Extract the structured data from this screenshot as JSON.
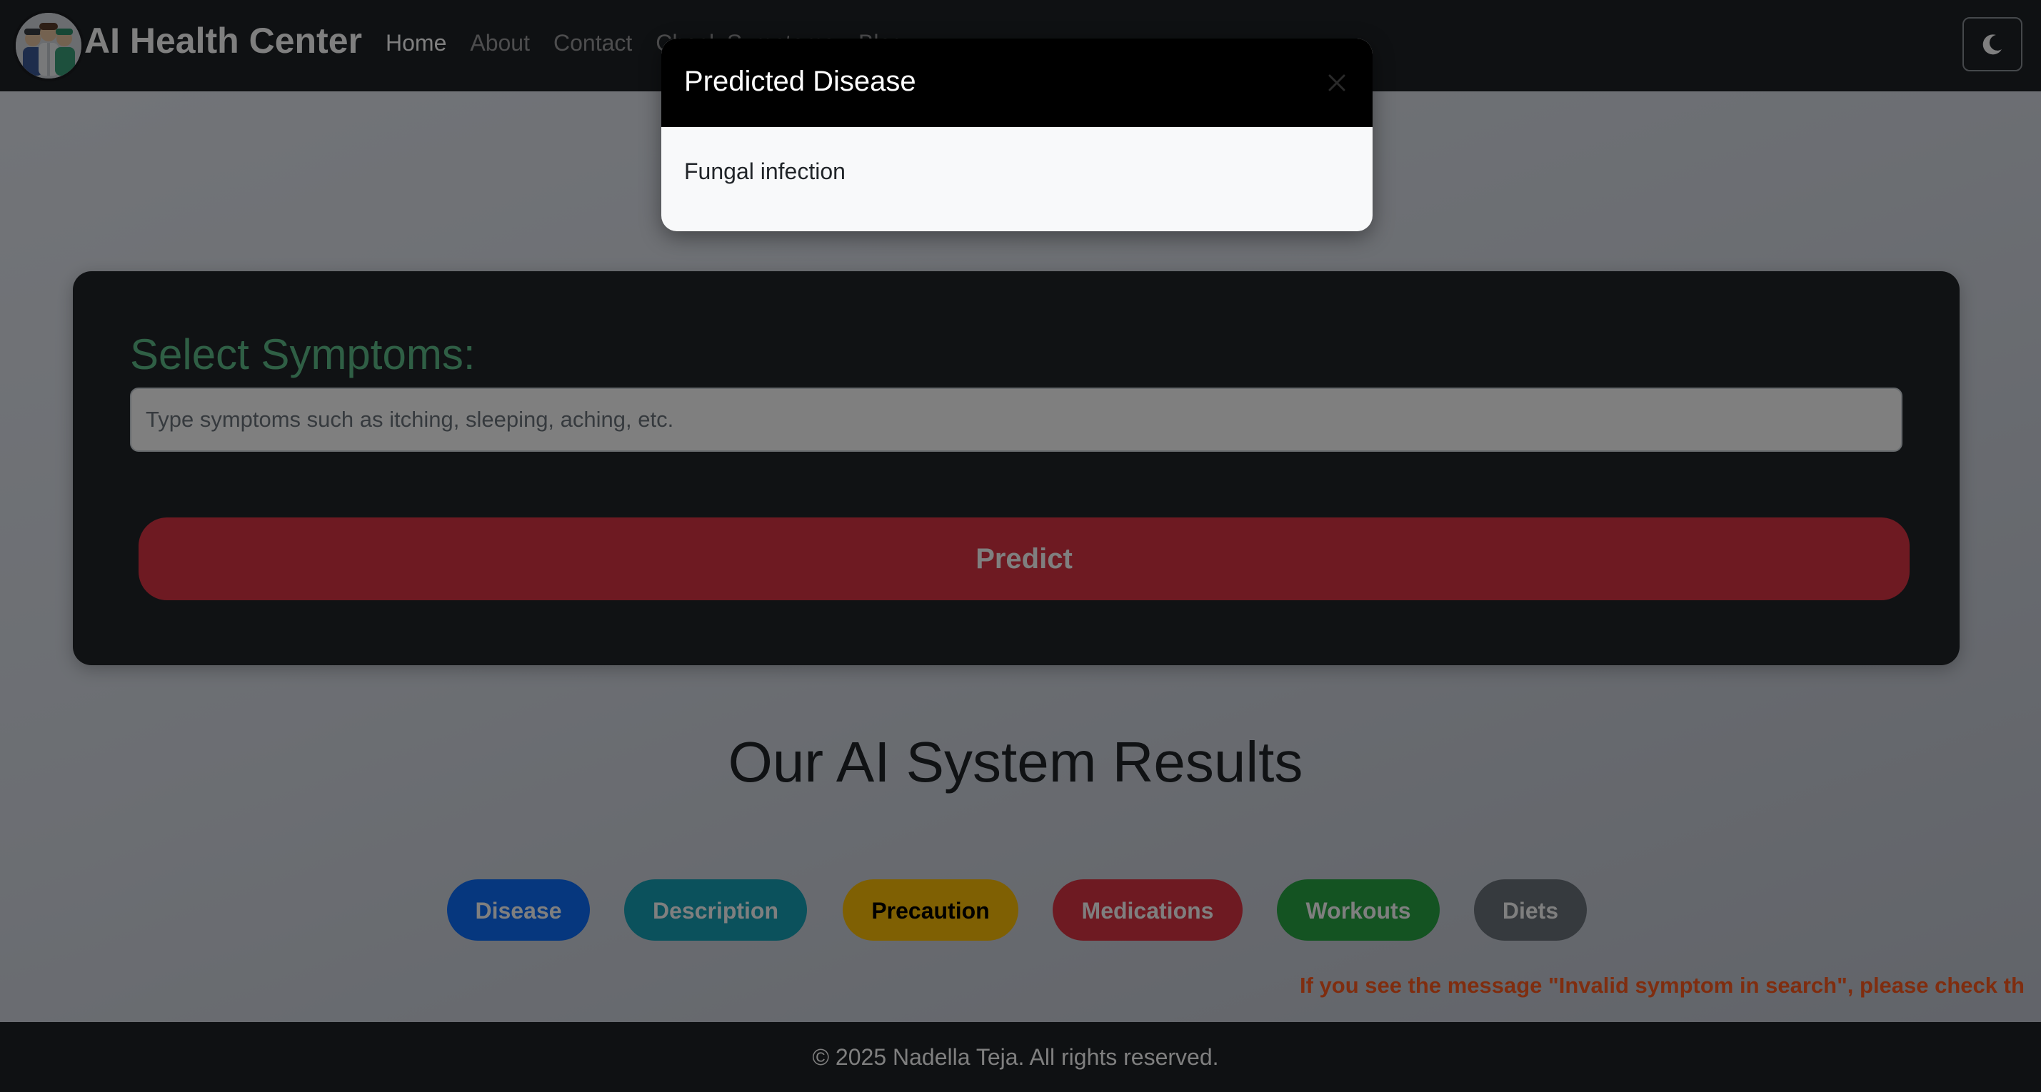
{
  "navbar": {
    "brand": "AI Health Center",
    "links": [
      "Home",
      "About",
      "Contact",
      "Check Symptoms",
      "Blog"
    ],
    "active_link": "Home",
    "theme_toggle_icon": "moon-icon"
  },
  "symptoms": {
    "title": "Select Symptoms:",
    "input_placeholder": "Type symptoms such as itching, sleeping, aching, etc.",
    "input_value": "",
    "predict_label": "Predict"
  },
  "results": {
    "title": "Our AI System Results",
    "buttons": [
      {
        "label": "Disease",
        "color": "#0d6efd"
      },
      {
        "label": "Description",
        "color": "#17a2b8"
      },
      {
        "label": "Precaution",
        "color": "#ffc107"
      },
      {
        "label": "Medications",
        "color": "#dc3545"
      },
      {
        "label": "Workouts",
        "color": "#28a745"
      },
      {
        "label": "Diets",
        "color": "#6c757d"
      }
    ]
  },
  "notice": "If you see the message \"Invalid symptom in search\", please check th",
  "footer": {
    "text": "© 2025 Nadella Teja. All rights reserved."
  },
  "modal": {
    "title": "Predicted Disease",
    "close_icon": "close-icon",
    "body": "Fungal infection"
  },
  "colors": {
    "navbar_bg": "#1f2226",
    "card_bg": "#212529",
    "symptom_title": "#5fbf8a",
    "predict_bg": "#dc3545",
    "notice": "#ff5a1f",
    "modal_header_bg": "#000000"
  }
}
